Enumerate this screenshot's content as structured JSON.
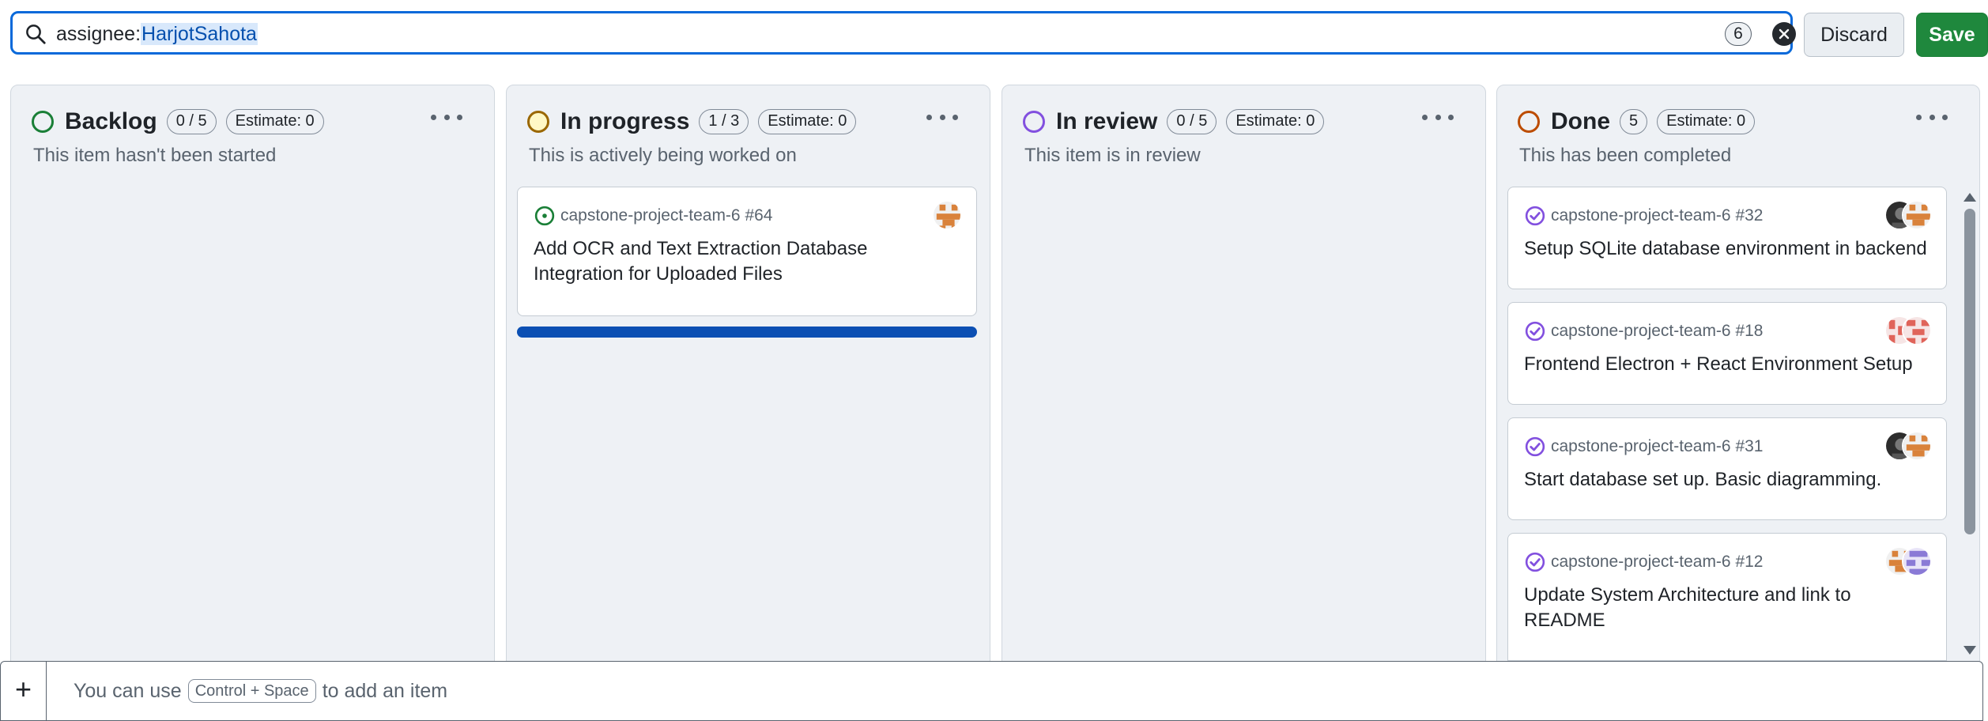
{
  "filter": {
    "key": "assignee:",
    "value": "HarjotSahota",
    "count": "6"
  },
  "buttons": {
    "discard": "Discard",
    "save": "Save"
  },
  "columns": [
    {
      "title": "Backlog",
      "count": "0 / 5",
      "estimate": "Estimate: 0",
      "description": "This item hasn't been started",
      "status_color": "#1a7f37"
    },
    {
      "title": "In progress",
      "count": "1 / 3",
      "estimate": "Estimate: 0",
      "description": "This is actively being worked on",
      "status_color": "#9a6700"
    },
    {
      "title": "In review",
      "count": "0 / 5",
      "estimate": "Estimate: 0",
      "description": "This item is in review",
      "status_color": "#8250df"
    },
    {
      "title": "Done",
      "count": "5",
      "estimate": "Estimate: 0",
      "description": "This has been completed",
      "status_color": "#bc4c00"
    }
  ],
  "cards": {
    "in_progress": [
      {
        "repo": "capstone-project-team-6 #64",
        "title": "Add OCR and Text Extraction Database Integration for Uploaded Files",
        "state": "open"
      }
    ],
    "done": [
      {
        "repo": "capstone-project-team-6 #32",
        "title": "Setup SQLite database environment in backend",
        "state": "closed"
      },
      {
        "repo": "capstone-project-team-6 #18",
        "title": "Frontend Electron + React Environment Setup",
        "state": "closed"
      },
      {
        "repo": "capstone-project-team-6 #31",
        "title": "Start database set up. Basic diagramming.",
        "state": "closed"
      },
      {
        "repo": "capstone-project-team-6 #12",
        "title": "Update System Architecture and link to README",
        "state": "closed"
      }
    ]
  },
  "add_bar": {
    "prefix": "You can use",
    "shortcut": "Control + Space",
    "suffix": "to add an item"
  },
  "icons": {
    "search": "search-icon",
    "clear": "x-circle-fill-icon",
    "open_issue": "issue-opened-icon",
    "closed_issue": "issue-closed-icon",
    "plus": "plus-icon",
    "kebab": "kebab-horizontal-icon"
  },
  "colors": {
    "accent": "#0969da",
    "save_green": "#1f883d",
    "open_green": "#1a7f37",
    "closed_purple": "#8250df",
    "progress_blue": "#0b4fb3"
  }
}
